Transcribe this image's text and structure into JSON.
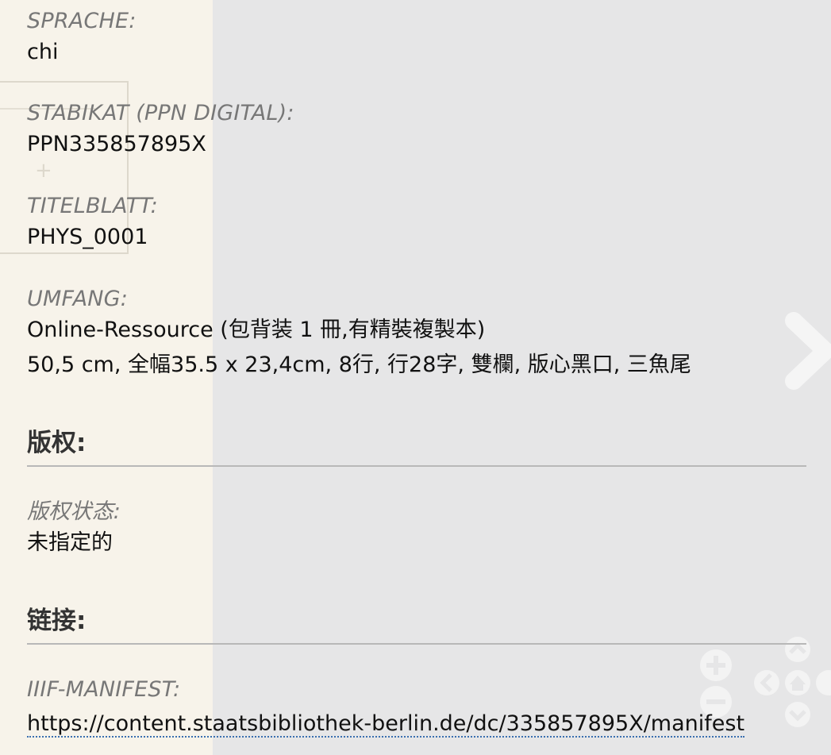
{
  "fields": {
    "sprache": {
      "label": "SPRACHE:",
      "value": "chi"
    },
    "stabikat": {
      "label": "STABIKAT (PPN DIGITAL):",
      "value": "PPN335857895X"
    },
    "titelblatt": {
      "label": "TITELBLATT:",
      "value": "PHYS_0001"
    },
    "umfang": {
      "label": "UMFANG:",
      "value_line1": "Online-Ressource (包背装 1 冊,有精裝複製本)",
      "value_line2": "50,5 cm, 全幅35.5 x 23,4cm, 8行, 行28字, 雙欄, 版心黑口, 三魚尾"
    }
  },
  "sections": {
    "copyright": {
      "title": "版权:",
      "status_label": "版权状态:",
      "status_value": "未指定的"
    },
    "links": {
      "title": "链接:",
      "iiif_label": "IIIF-MANIFEST:",
      "iiif_url": "https://content.staatsbibliothek-berlin.de/dc/335857895X/manifest"
    }
  },
  "viewer_controls": {
    "next_icon": "chevron-right-icon",
    "zoom_in_icon": "plus-circle-icon",
    "zoom_out_icon": "minus-circle-icon",
    "home_icon": "home-icon",
    "rotate_left_icon": "rotate-left-icon",
    "up_icon": "chevron-up-icon",
    "down_icon": "chevron-down-icon"
  },
  "colors": {
    "background": "#e6e6e7",
    "label": "#777777",
    "value": "#111111",
    "link_underline": "#3a6fb0"
  }
}
